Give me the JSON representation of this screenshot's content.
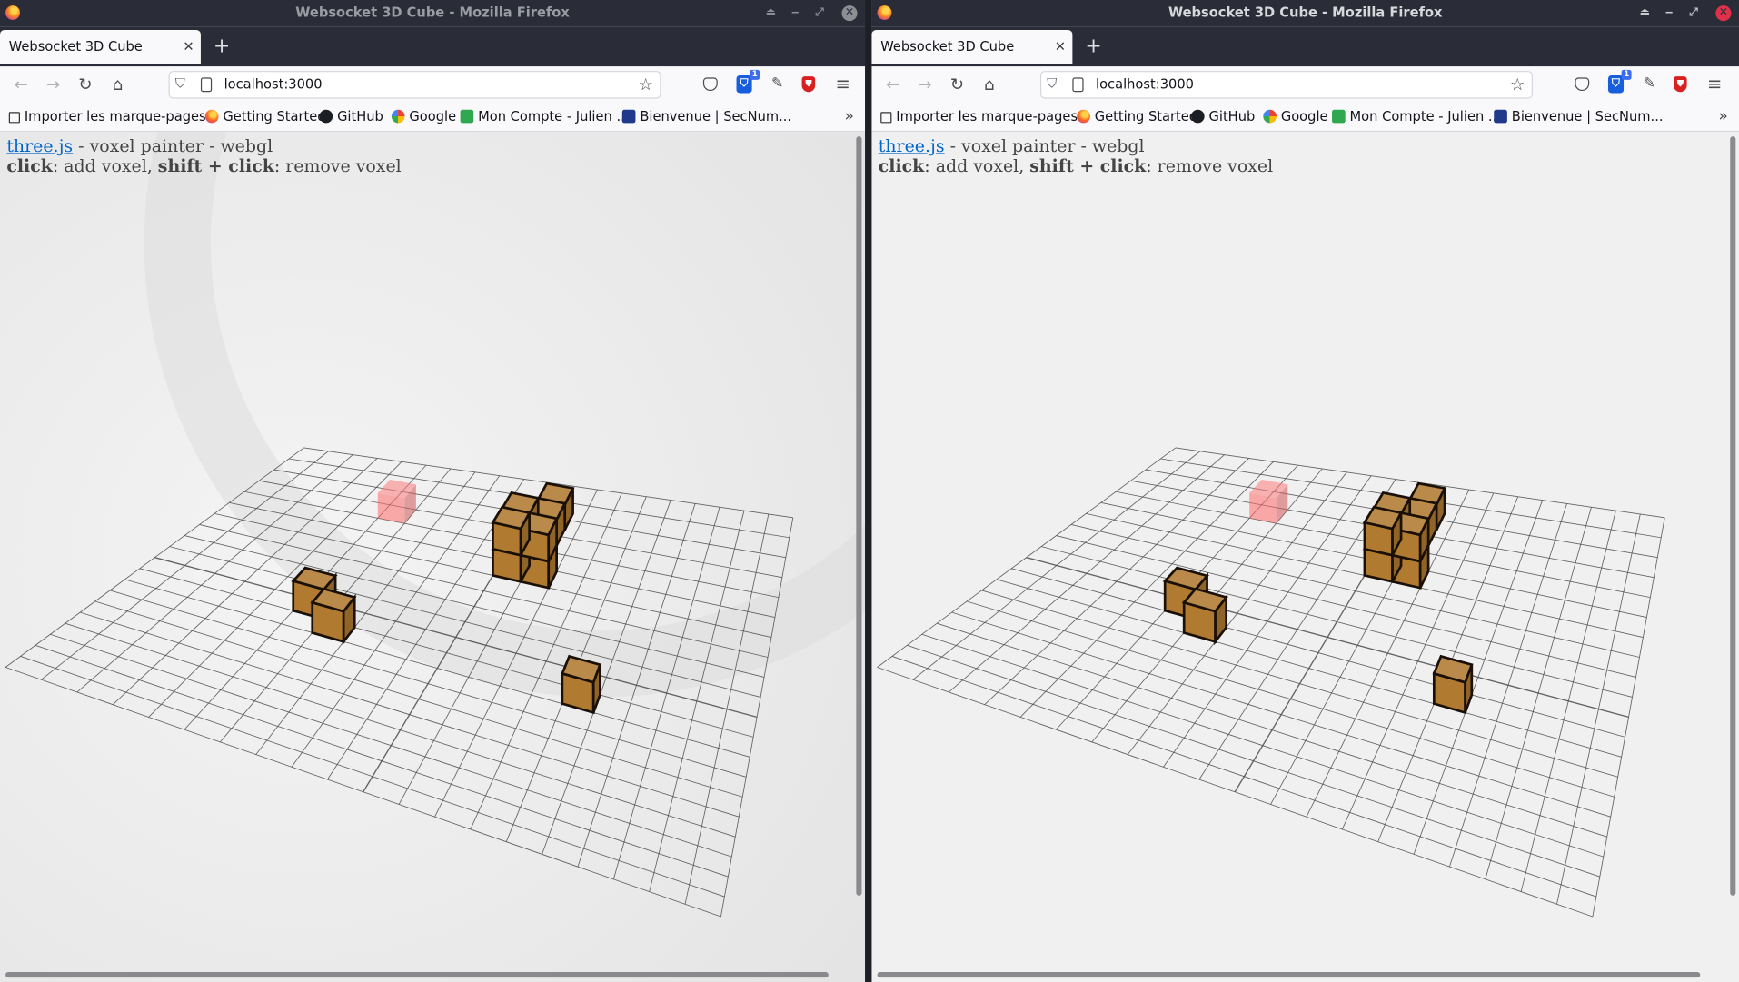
{
  "windows": [
    {
      "id": "left",
      "title": "Websocket 3D Cube - Mozilla Firefox",
      "tab_title": "Websocket 3D Cube",
      "url": "localhost:3000",
      "bitwarden_badge": "1",
      "bookmarks": [
        "Importer les marque-pages...",
        "Getting Started",
        "GitHub",
        "Google",
        "Mon Compte - Julien ...",
        "Bienvenue | SecNum..."
      ],
      "info": {
        "link": "three.js",
        "line1_rest": " - voxel painter - webgl",
        "click": "click",
        "add": ": add voxel, ",
        "shift": "shift + click",
        "remove": ": remove voxel"
      },
      "active": false
    },
    {
      "id": "right",
      "title": "Websocket 3D Cube - Mozilla Firefox",
      "tab_title": "Websocket 3D Cube",
      "url": "localhost:3000",
      "bitwarden_badge": "1",
      "bookmarks": [
        "Importer les marque-pages...",
        "Getting Started",
        "GitHub",
        "Google",
        "Mon Compte - Julien ...",
        "Bienvenue | SecNum..."
      ],
      "info": {
        "link": "three.js",
        "line1_rest": " - voxel painter - webgl",
        "click": "click",
        "add": ": add voxel, ",
        "shift": "shift + click",
        "remove": ": remove voxel"
      },
      "active": true
    }
  ],
  "scene": {
    "grid_divisions": 20,
    "voxel_color": "#b07a30",
    "voxel_edge_color": "#1a1008",
    "rollover_color": "#ff6b6b",
    "grid_color": "#4a4a4a",
    "voxel_count": 10
  },
  "icons": {
    "back": "arrow-left-icon",
    "forward": "arrow-right-icon",
    "reload": "reload-icon",
    "home": "home-icon",
    "tracking": "shield-icon",
    "page": "page-icon",
    "bookmark": "star-icon",
    "pocket": "pocket-icon",
    "bitwarden": "bitwarden-icon",
    "eyedropper": "eyedropper-icon",
    "ublock": "ublock-icon",
    "menu": "hamburger-menu-icon"
  }
}
